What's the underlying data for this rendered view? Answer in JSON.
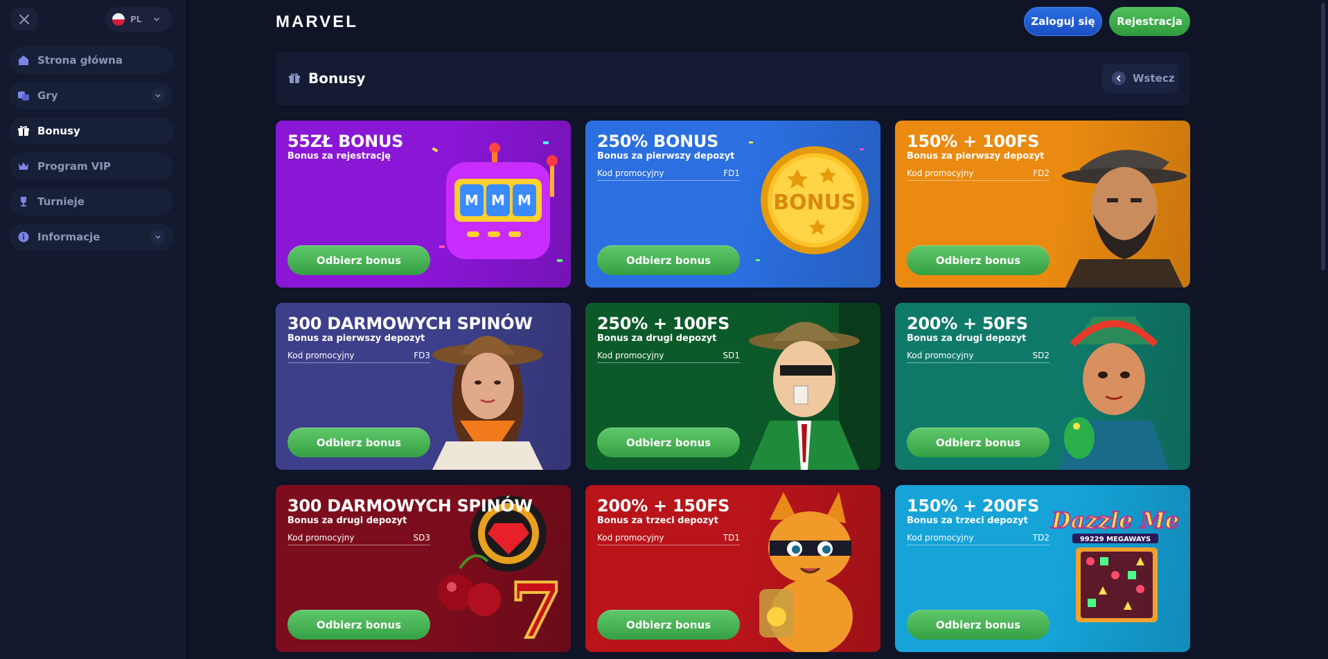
{
  "sidebar": {
    "language": {
      "code": "PL"
    },
    "items": [
      {
        "label": "Strona główna",
        "icon": "home-icon",
        "has_submenu": false
      },
      {
        "label": "Gry",
        "icon": "games-icon",
        "has_submenu": true
      },
      {
        "label": "Bonusy",
        "icon": "gift-icon",
        "has_submenu": false,
        "active": true
      },
      {
        "label": "Program VIP",
        "icon": "crown-icon",
        "has_submenu": false
      },
      {
        "label": "Turnieje",
        "icon": "trophy-icon",
        "has_submenu": false
      },
      {
        "label": "Informacje",
        "icon": "info-icon",
        "has_submenu": true
      }
    ]
  },
  "header": {
    "logo": "MARVEL",
    "login_label": "Zaloguj się",
    "register_label": "Rejestracja"
  },
  "section": {
    "title": "Bonusy",
    "back_label": "Wstecz"
  },
  "claim_label": "Odbierz bonus",
  "promo_label": "Kod promocyjny",
  "cards": [
    {
      "title": "55ZŁ BONUS",
      "subtitle": "Bonus za rejestrację",
      "code": "",
      "bg": "#8a16d6",
      "art": "slot-machine"
    },
    {
      "title": "250% BONUS",
      "subtitle": "Bonus za pierwszy depozyt",
      "code": "FD1",
      "bg": "#2b6fe0",
      "art": "gold-coin"
    },
    {
      "title": "150% + 100FS",
      "subtitle": "Bonus za pierwszy depozyt",
      "code": "FD2",
      "bg": "#ea8a10",
      "art": "cowboy"
    },
    {
      "title": "300 DARMOWYCH SPINÓW",
      "subtitle": "Bonus za pierwszy depozyt",
      "code": "FD3",
      "bg": "#3d3f8a",
      "art": "explorer"
    },
    {
      "title": "250% + 100FS",
      "subtitle": "Bonus za drugi depozyt",
      "code": "SD1",
      "bg": "#0c5a2a",
      "art": "detective"
    },
    {
      "title": "200% + 50FS",
      "subtitle": "Bonus za drugi depozyt",
      "code": "SD2",
      "bg": "#0f7a6a",
      "art": "aztec"
    },
    {
      "title": "300 DARMOWYCH SPINÓW",
      "subtitle": "Bonus za drugi depozyt",
      "code": "SD3",
      "bg": "#7c0d1c",
      "art": "cherries"
    },
    {
      "title": "200% + 150FS",
      "subtitle": "Bonus za trzeci depozyt",
      "code": "TD1",
      "bg": "#b8141a",
      "art": "cat"
    },
    {
      "title": "150% + 200FS",
      "subtitle": "Bonus za trzeci depozyt",
      "code": "TD2",
      "bg": "#15a3d8",
      "art": "dazzle",
      "art_text": "Dazzle Me",
      "art_subtext": "99229 MEGAWAYS"
    }
  ]
}
